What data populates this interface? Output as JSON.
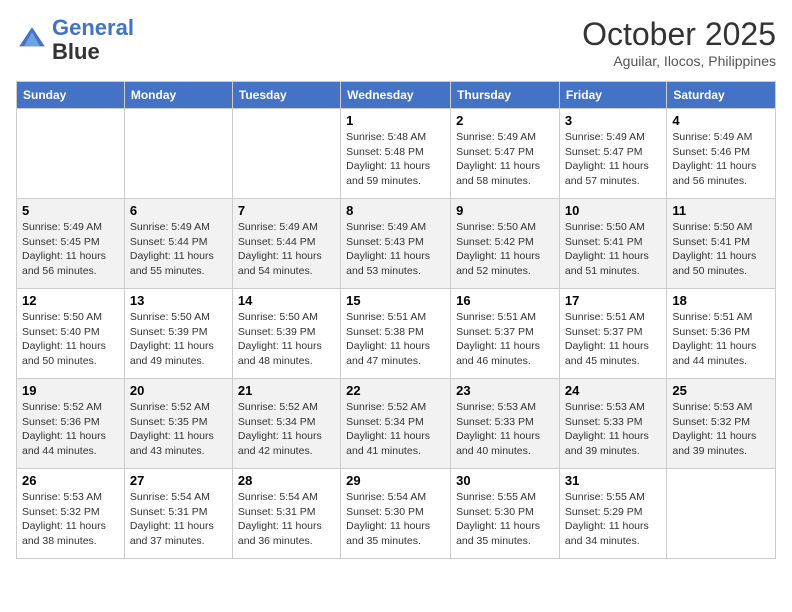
{
  "header": {
    "logo_line1": "General",
    "logo_line2": "Blue",
    "month": "October 2025",
    "location": "Aguilar, Ilocos, Philippines"
  },
  "weekdays": [
    "Sunday",
    "Monday",
    "Tuesday",
    "Wednesday",
    "Thursday",
    "Friday",
    "Saturday"
  ],
  "weeks": [
    [
      {
        "day": "",
        "info": ""
      },
      {
        "day": "",
        "info": ""
      },
      {
        "day": "",
        "info": ""
      },
      {
        "day": "1",
        "info": "Sunrise: 5:48 AM\nSunset: 5:48 PM\nDaylight: 11 hours\nand 59 minutes."
      },
      {
        "day": "2",
        "info": "Sunrise: 5:49 AM\nSunset: 5:47 PM\nDaylight: 11 hours\nand 58 minutes."
      },
      {
        "day": "3",
        "info": "Sunrise: 5:49 AM\nSunset: 5:47 PM\nDaylight: 11 hours\nand 57 minutes."
      },
      {
        "day": "4",
        "info": "Sunrise: 5:49 AM\nSunset: 5:46 PM\nDaylight: 11 hours\nand 56 minutes."
      }
    ],
    [
      {
        "day": "5",
        "info": "Sunrise: 5:49 AM\nSunset: 5:45 PM\nDaylight: 11 hours\nand 56 minutes."
      },
      {
        "day": "6",
        "info": "Sunrise: 5:49 AM\nSunset: 5:44 PM\nDaylight: 11 hours\nand 55 minutes."
      },
      {
        "day": "7",
        "info": "Sunrise: 5:49 AM\nSunset: 5:44 PM\nDaylight: 11 hours\nand 54 minutes."
      },
      {
        "day": "8",
        "info": "Sunrise: 5:49 AM\nSunset: 5:43 PM\nDaylight: 11 hours\nand 53 minutes."
      },
      {
        "day": "9",
        "info": "Sunrise: 5:50 AM\nSunset: 5:42 PM\nDaylight: 11 hours\nand 52 minutes."
      },
      {
        "day": "10",
        "info": "Sunrise: 5:50 AM\nSunset: 5:41 PM\nDaylight: 11 hours\nand 51 minutes."
      },
      {
        "day": "11",
        "info": "Sunrise: 5:50 AM\nSunset: 5:41 PM\nDaylight: 11 hours\nand 50 minutes."
      }
    ],
    [
      {
        "day": "12",
        "info": "Sunrise: 5:50 AM\nSunset: 5:40 PM\nDaylight: 11 hours\nand 50 minutes."
      },
      {
        "day": "13",
        "info": "Sunrise: 5:50 AM\nSunset: 5:39 PM\nDaylight: 11 hours\nand 49 minutes."
      },
      {
        "day": "14",
        "info": "Sunrise: 5:50 AM\nSunset: 5:39 PM\nDaylight: 11 hours\nand 48 minutes."
      },
      {
        "day": "15",
        "info": "Sunrise: 5:51 AM\nSunset: 5:38 PM\nDaylight: 11 hours\nand 47 minutes."
      },
      {
        "day": "16",
        "info": "Sunrise: 5:51 AM\nSunset: 5:37 PM\nDaylight: 11 hours\nand 46 minutes."
      },
      {
        "day": "17",
        "info": "Sunrise: 5:51 AM\nSunset: 5:37 PM\nDaylight: 11 hours\nand 45 minutes."
      },
      {
        "day": "18",
        "info": "Sunrise: 5:51 AM\nSunset: 5:36 PM\nDaylight: 11 hours\nand 44 minutes."
      }
    ],
    [
      {
        "day": "19",
        "info": "Sunrise: 5:52 AM\nSunset: 5:36 PM\nDaylight: 11 hours\nand 44 minutes."
      },
      {
        "day": "20",
        "info": "Sunrise: 5:52 AM\nSunset: 5:35 PM\nDaylight: 11 hours\nand 43 minutes."
      },
      {
        "day": "21",
        "info": "Sunrise: 5:52 AM\nSunset: 5:34 PM\nDaylight: 11 hours\nand 42 minutes."
      },
      {
        "day": "22",
        "info": "Sunrise: 5:52 AM\nSunset: 5:34 PM\nDaylight: 11 hours\nand 41 minutes."
      },
      {
        "day": "23",
        "info": "Sunrise: 5:53 AM\nSunset: 5:33 PM\nDaylight: 11 hours\nand 40 minutes."
      },
      {
        "day": "24",
        "info": "Sunrise: 5:53 AM\nSunset: 5:33 PM\nDaylight: 11 hours\nand 39 minutes."
      },
      {
        "day": "25",
        "info": "Sunrise: 5:53 AM\nSunset: 5:32 PM\nDaylight: 11 hours\nand 39 minutes."
      }
    ],
    [
      {
        "day": "26",
        "info": "Sunrise: 5:53 AM\nSunset: 5:32 PM\nDaylight: 11 hours\nand 38 minutes."
      },
      {
        "day": "27",
        "info": "Sunrise: 5:54 AM\nSunset: 5:31 PM\nDaylight: 11 hours\nand 37 minutes."
      },
      {
        "day": "28",
        "info": "Sunrise: 5:54 AM\nSunset: 5:31 PM\nDaylight: 11 hours\nand 36 minutes."
      },
      {
        "day": "29",
        "info": "Sunrise: 5:54 AM\nSunset: 5:30 PM\nDaylight: 11 hours\nand 35 minutes."
      },
      {
        "day": "30",
        "info": "Sunrise: 5:55 AM\nSunset: 5:30 PM\nDaylight: 11 hours\nand 35 minutes."
      },
      {
        "day": "31",
        "info": "Sunrise: 5:55 AM\nSunset: 5:29 PM\nDaylight: 11 hours\nand 34 minutes."
      },
      {
        "day": "",
        "info": ""
      }
    ]
  ]
}
